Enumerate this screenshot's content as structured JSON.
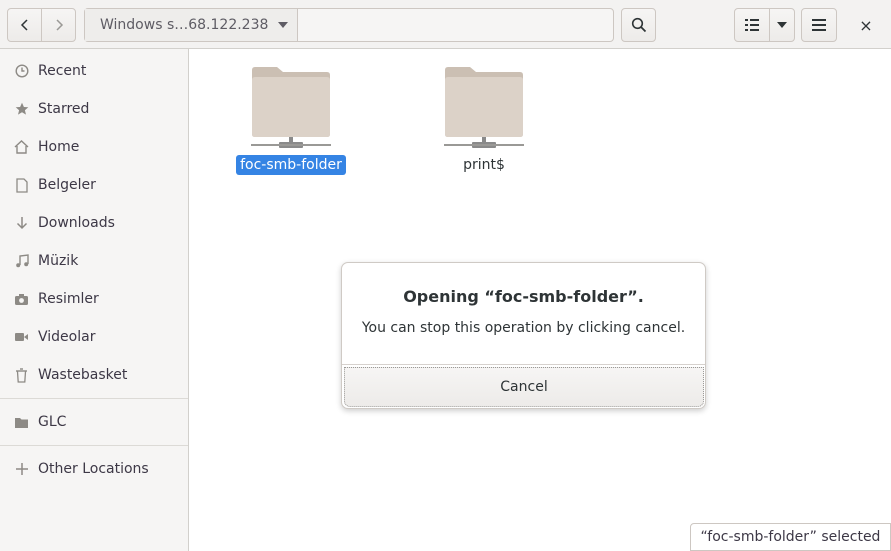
{
  "toolbar": {
    "path_label": "Windows s…68.122.238",
    "back_icon": "chevron-left",
    "forward_icon": "chevron-right",
    "search_icon": "magnifier",
    "view_icon": "list-view",
    "menu_icon": "hamburger",
    "close_glyph": "×"
  },
  "sidebar": {
    "items": [
      {
        "label": "Recent",
        "icon": "clock"
      },
      {
        "label": "Starred",
        "icon": "star"
      },
      {
        "label": "Home",
        "icon": "home"
      },
      {
        "label": "Belgeler",
        "icon": "document"
      },
      {
        "label": "Downloads",
        "icon": "arrow-down"
      },
      {
        "label": "Müzik",
        "icon": "music"
      },
      {
        "label": "Resimler",
        "icon": "camera"
      },
      {
        "label": "Videolar",
        "icon": "video"
      },
      {
        "label": "Wastebasket",
        "icon": "trash"
      },
      {
        "label": "GLC",
        "icon": "folder"
      },
      {
        "label": "Other Locations",
        "icon": "plus"
      }
    ]
  },
  "content": {
    "folders": [
      {
        "name": "foc-smb-folder",
        "selected": true
      },
      {
        "name": "print$",
        "selected": false
      }
    ]
  },
  "dialog": {
    "title": "Opening “foc-smb-folder”.",
    "message": "You can stop this operation by clicking cancel.",
    "cancel_label": "Cancel"
  },
  "status": {
    "text": "“foc-smb-folder” selected"
  },
  "colors": {
    "selection": "#3584e4",
    "folder": "#dcd2c8",
    "folder_tab": "#cbbfb3"
  }
}
